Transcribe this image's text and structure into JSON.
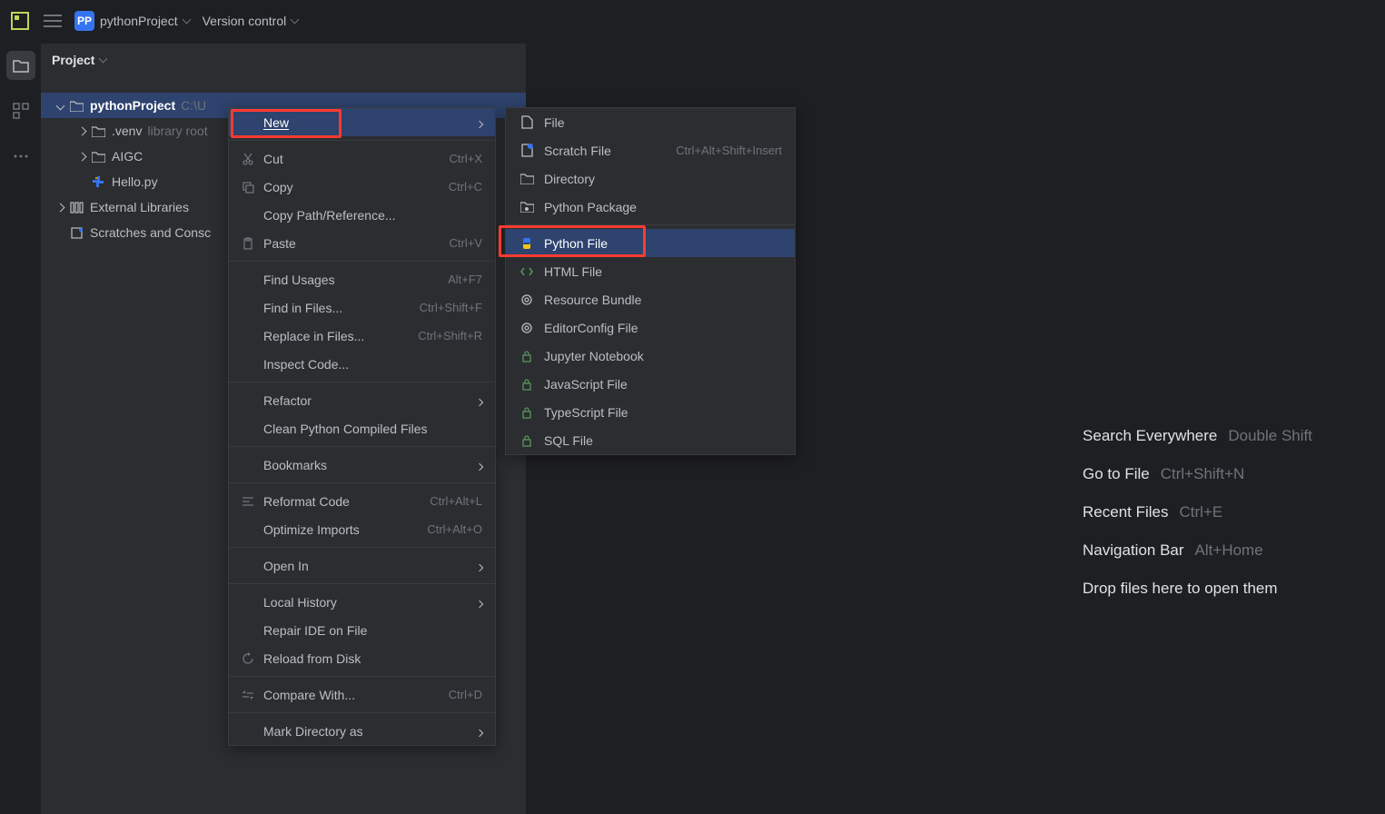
{
  "topbar": {
    "badge": "PP",
    "project_name": "pythonProject",
    "version_control": "Version control"
  },
  "project_panel": {
    "title": "Project",
    "root": "pythonProject",
    "root_path": "C:\\U",
    "venv": ".venv",
    "venv_hint": "library root",
    "aigc": "AIGC",
    "hello": "Hello.py",
    "ext_libs": "External Libraries",
    "scratches": "Scratches and Consc"
  },
  "menu1": {
    "new": "New",
    "cut": "Cut",
    "cut_k": "Ctrl+X",
    "copy": "Copy",
    "copy_k": "Ctrl+C",
    "copy_path": "Copy Path/Reference...",
    "paste": "Paste",
    "paste_k": "Ctrl+V",
    "find_usages": "Find Usages",
    "find_usages_k": "Alt+F7",
    "find_in_files": "Find in Files...",
    "find_in_files_k": "Ctrl+Shift+F",
    "replace_in_files": "Replace in Files...",
    "replace_in_files_k": "Ctrl+Shift+R",
    "inspect": "Inspect Code...",
    "refactor": "Refactor",
    "clean": "Clean Python Compiled Files",
    "bookmarks": "Bookmarks",
    "reformat": "Reformat Code",
    "reformat_k": "Ctrl+Alt+L",
    "optimize": "Optimize Imports",
    "optimize_k": "Ctrl+Alt+O",
    "open_in": "Open In",
    "local_history": "Local History",
    "repair": "Repair IDE on File",
    "reload": "Reload from Disk",
    "compare": "Compare With...",
    "compare_k": "Ctrl+D",
    "mark_dir": "Mark Directory as"
  },
  "menu2": {
    "file": "File",
    "scratch": "Scratch File",
    "scratch_k": "Ctrl+Alt+Shift+Insert",
    "directory": "Directory",
    "py_package": "Python Package",
    "py_file": "Python File",
    "html": "HTML File",
    "resource": "Resource Bundle",
    "editorconfig": "EditorConfig File",
    "jupyter": "Jupyter Notebook",
    "js": "JavaScript File",
    "ts": "TypeScript File",
    "sql": "SQL File"
  },
  "hints": {
    "search": "Search Everywhere",
    "search_k": "Double Shift",
    "goto": "Go to File",
    "goto_k": "Ctrl+Shift+N",
    "recent": "Recent Files",
    "recent_k": "Ctrl+E",
    "nav": "Navigation Bar",
    "nav_k": "Alt+Home",
    "drop": "Drop files here to open them"
  }
}
